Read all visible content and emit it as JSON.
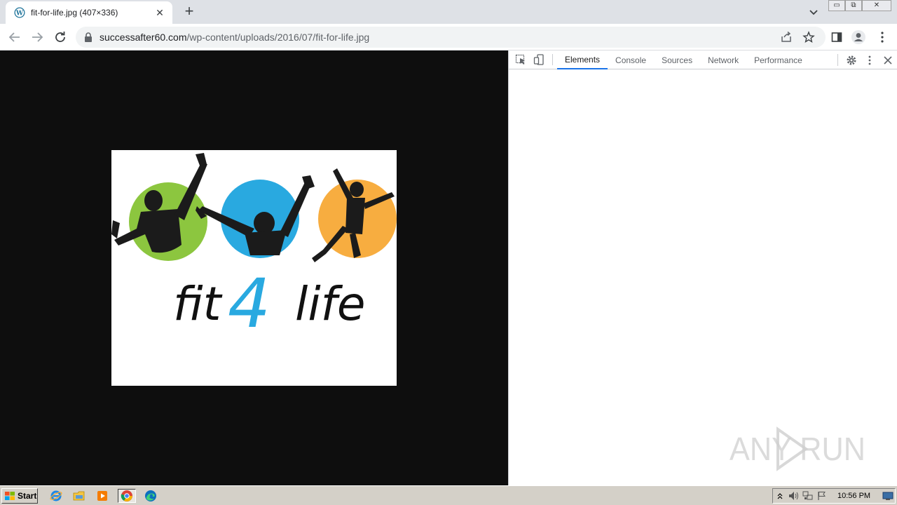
{
  "tab": {
    "title": "fit-for-life.jpg (407×336)",
    "close": "✕"
  },
  "newtab": "+",
  "window_buttons": {
    "minimize": "▭",
    "restore": "⧉",
    "close": "✕"
  },
  "omnibox": {
    "host": "successafter60.com",
    "path": "/wp-content/uploads/2016/07/fit-for-life.jpg"
  },
  "devtools": {
    "tabs": [
      "Elements",
      "Console",
      "Sources",
      "Network",
      "Performance"
    ],
    "active_tab": "Elements"
  },
  "image_logo": {
    "word_left": "fit",
    "digit": "4",
    "word_right": "life",
    "colors": {
      "green": "#8cc63f",
      "blue": "#29a9e0",
      "orange": "#f7ad40"
    }
  },
  "watermark": "ANY RUN",
  "taskbar": {
    "start": "Start",
    "clock": "10:56 PM"
  },
  "colors": {
    "viewport_bg": "#0e0e0e",
    "accent": "#1a73e8",
    "taskbar": "#d4d0c8"
  }
}
